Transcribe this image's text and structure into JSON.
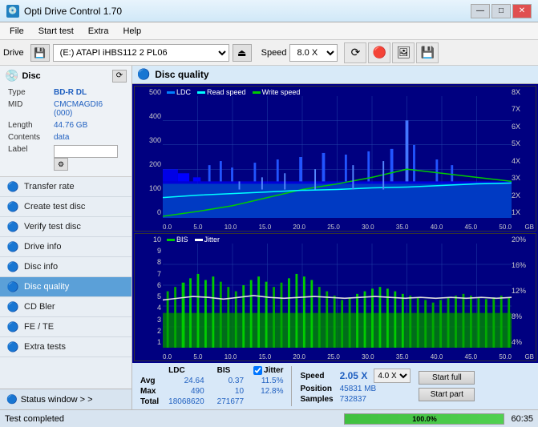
{
  "app": {
    "title": "Opti Drive Control 1.70",
    "icon": "💿"
  },
  "titlebar": {
    "minimize": "—",
    "maximize": "□",
    "close": "✕"
  },
  "menubar": {
    "items": [
      "File",
      "Start test",
      "Extra",
      "Help"
    ]
  },
  "drivebar": {
    "label": "Drive",
    "drive_value": "(E:)  ATAPI iHBS112  2 PL06",
    "speed_label": "Speed",
    "speed_value": "8.0 X"
  },
  "disc": {
    "title": "Disc",
    "type_label": "Type",
    "type_value": "BD-R DL",
    "mid_label": "MID",
    "mid_value": "CMCMAGDI6 (000)",
    "length_label": "Length",
    "length_value": "44.76 GB",
    "contents_label": "Contents",
    "contents_value": "data",
    "label_label": "Label",
    "label_value": ""
  },
  "sidebar": {
    "items": [
      {
        "id": "transfer-rate",
        "label": "Transfer rate",
        "icon": "📈"
      },
      {
        "id": "create-test-disc",
        "label": "Create test disc",
        "icon": "💾"
      },
      {
        "id": "verify-test-disc",
        "label": "Verify test disc",
        "icon": "✔"
      },
      {
        "id": "drive-info",
        "label": "Drive info",
        "icon": "ℹ"
      },
      {
        "id": "disc-info",
        "label": "Disc info",
        "icon": "📀"
      },
      {
        "id": "disc-quality",
        "label": "Disc quality",
        "icon": "🔵",
        "active": true
      },
      {
        "id": "cd-bler",
        "label": "CD Bler",
        "icon": "📊"
      },
      {
        "id": "fe-te",
        "label": "FE / TE",
        "icon": "📉"
      },
      {
        "id": "extra-tests",
        "label": "Extra tests",
        "icon": "🔧"
      }
    ],
    "status_window": "Status window > >"
  },
  "chart": {
    "title": "Disc quality",
    "top": {
      "legend": [
        {
          "label": "LDC",
          "color": "#0080ff"
        },
        {
          "label": "Read speed",
          "color": "#00ffff"
        },
        {
          "label": "Write speed",
          "color": "#00ff00"
        }
      ],
      "y_labels": [
        "500",
        "400",
        "300",
        "200",
        "100",
        "0"
      ],
      "y_labels_right": [
        "8X",
        "7X",
        "6X",
        "5X",
        "4X",
        "3X",
        "2X",
        "1X"
      ],
      "x_labels": [
        "0.0",
        "5.0",
        "10.0",
        "15.0",
        "20.0",
        "25.0",
        "30.0",
        "35.0",
        "40.0",
        "45.0",
        "50.0"
      ],
      "x_unit": "GB"
    },
    "bottom": {
      "legend": [
        {
          "label": "BIS",
          "color": "#00cc00"
        },
        {
          "label": "Jitter",
          "color": "#ffffff"
        }
      ],
      "y_labels": [
        "10",
        "9",
        "8",
        "7",
        "6",
        "5",
        "4",
        "3",
        "2",
        "1"
      ],
      "y_labels_right": [
        "20%",
        "16%",
        "12%",
        "8%",
        "4%"
      ],
      "x_labels": [
        "0.0",
        "5.0",
        "10.0",
        "15.0",
        "20.0",
        "25.0",
        "30.0",
        "35.0",
        "40.0",
        "45.0",
        "50.0"
      ],
      "x_unit": "GB"
    }
  },
  "stats": {
    "ldc_label": "LDC",
    "bis_label": "BIS",
    "jitter_label": "Jitter",
    "jitter_checked": true,
    "speed_label": "Speed",
    "speed_value": "2.05 X",
    "speed_select": "4.0 X",
    "position_label": "Position",
    "position_value": "45831 MB",
    "samples_label": "Samples",
    "samples_value": "732837",
    "avg_label": "Avg",
    "ldc_avg": "24.64",
    "bis_avg": "0.37",
    "jitter_avg": "11.5%",
    "max_label": "Max",
    "ldc_max": "490",
    "bis_max": "10",
    "jitter_max": "12.8%",
    "total_label": "Total",
    "ldc_total": "18068620",
    "bis_total": "271677",
    "start_full": "Start full",
    "start_part": "Start part"
  },
  "statusbar": {
    "text": "Test completed",
    "progress": 100,
    "progress_text": "100.0%",
    "time": "60:35"
  }
}
